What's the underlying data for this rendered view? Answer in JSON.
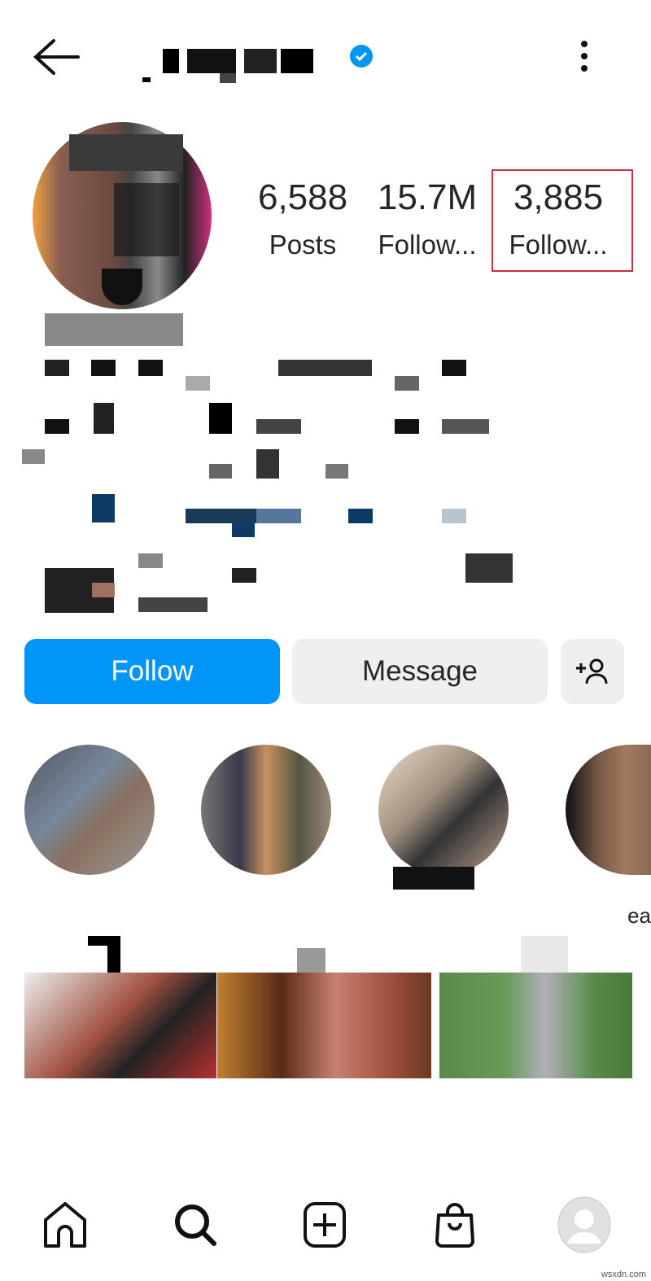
{
  "header": {
    "back_icon": "arrow-left-icon",
    "username_pixelated": true,
    "verified_icon": "verified-badge-icon",
    "verified_color": "#0095f6",
    "more_icon": "more-vertical-icon"
  },
  "stats": [
    {
      "value": "6,588",
      "label": "Posts"
    },
    {
      "value": "15.7M",
      "label": "Follow..."
    },
    {
      "value": "3,885",
      "label": "Follow..."
    }
  ],
  "highlight_box_color": "#d0303a",
  "actions": {
    "follow": "Follow",
    "message": "Message",
    "add_user_icon": "add-person-icon",
    "follow_color": "#0095f6",
    "message_bg": "#efefef"
  },
  "highlights": {
    "partial_label": "ea"
  },
  "nav": [
    {
      "icon": "home-icon"
    },
    {
      "icon": "search-icon"
    },
    {
      "icon": "create-icon"
    },
    {
      "icon": "shop-icon"
    },
    {
      "icon": "profile-avatar-icon"
    }
  ],
  "watermark": "wsxdn.com"
}
